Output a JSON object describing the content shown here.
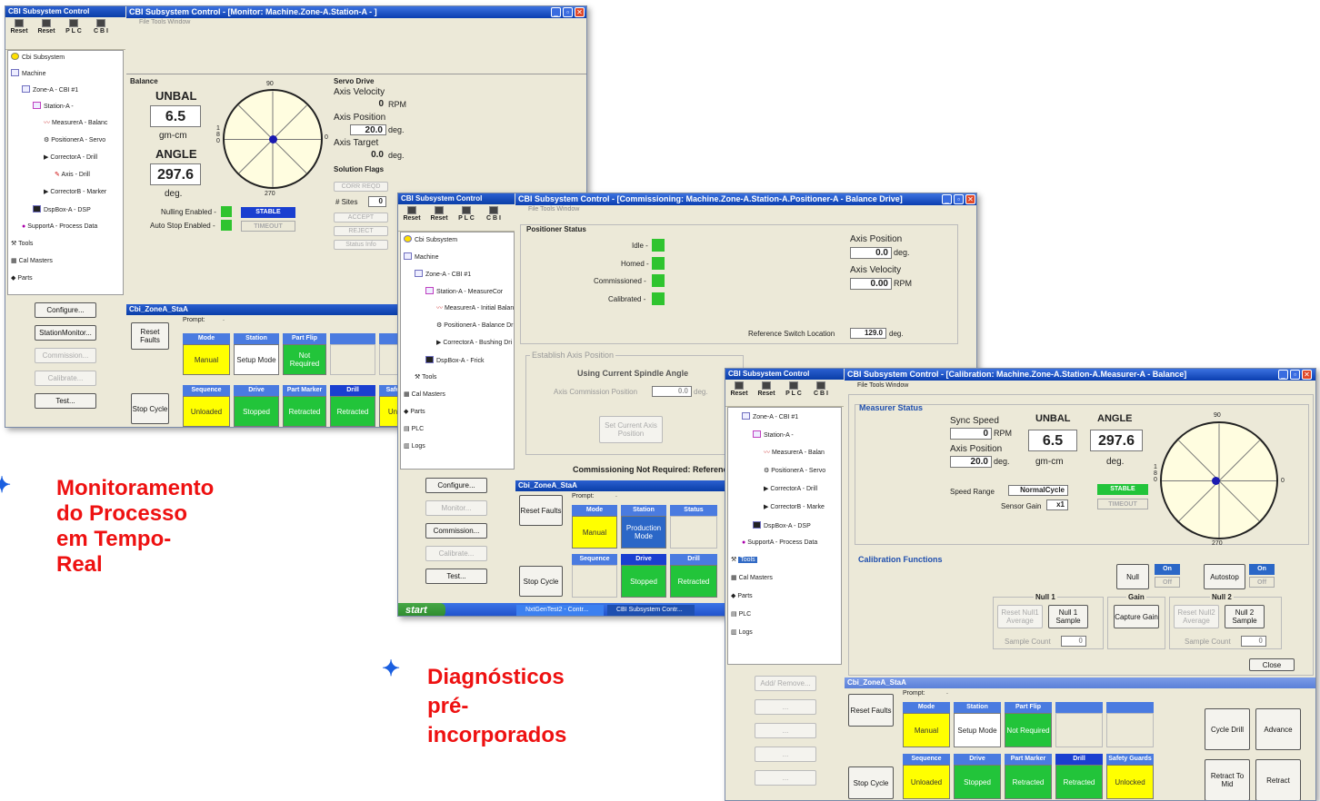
{
  "captions": [
    {
      "text": "Monitoramento do Processo em Tempo-Real",
      "lines": [
        "Monitoramento",
        "do Processo",
        "em Tempo-",
        "Real"
      ]
    },
    {
      "text": "Diagnósticos pré-incorporados",
      "lines": [
        "Diagnósticos",
        "pré-",
        "incorporados"
      ]
    }
  ],
  "sidebar": {
    "title": "CBI Subsystem Control",
    "toolbar": [
      "Reset",
      "Reset",
      "P L C",
      "C B I"
    ]
  },
  "w1": {
    "title": "CBI Subsystem Control - [Monitor: Machine.Zone-A.Station-A - ]",
    "menu": "File   Tools   Window",
    "tree": [
      "Cbi Subsystem",
      "Machine",
      "Zone-A - CBI #1",
      "Station-A -",
      "MeasurerA - Balanc",
      "PositionerA - Servo",
      "CorrectorA - Drill",
      "Axis - Drill",
      "CorrectorB - Marker",
      "DspBox-A - DSP",
      "SupportA - Process Data",
      "Tools",
      "Cal Masters",
      "Parts"
    ],
    "buttons": [
      "Configure...",
      "StationMonitor...",
      "Commission...",
      "Calibrate...",
      "Test..."
    ],
    "balance": {
      "title": "Balance",
      "unbal_label": "UNBAL",
      "unbal": "6.5",
      "unit": "gm-cm",
      "angle_label": "ANGLE",
      "angle": "297.6",
      "deg": "deg.",
      "null": "Nulling Enabled -",
      "auto": "Auto Stop Enabled -",
      "stable": "STABLE",
      "timeout": "TIMEOUT",
      "dial": {
        "top": "90",
        "bottom": "270",
        "left": "180",
        "right": "0"
      }
    },
    "servo": {
      "title": "Servo Drive",
      "vel_label": "Axis Velocity",
      "vel": "0",
      "vel_unit": "RPM",
      "pos_label": "Axis Position",
      "pos": "20.0",
      "pos_unit": "deg.",
      "tgt_label": "Axis Target",
      "tgt": "0.0",
      "tgt_unit": "deg.",
      "flags": "Solution Flags",
      "corr": "CORR REQD",
      "sites_label": "# Sites",
      "sites": "0",
      "accept": "ACCEPT",
      "reject": "REJECT",
      "status": "Status Info"
    },
    "station": {
      "title": "Cbi_ZoneA_StaA",
      "prompt": "Prompt:",
      "prompt_val": ".",
      "reset": "Reset Faults",
      "stop": "Stop Cycle",
      "heads1": [
        "Mode",
        "Station",
        "Part Flip",
        "",
        ""
      ],
      "row1": [
        "Manual",
        "Setup Mode",
        "Not Required",
        "",
        ""
      ],
      "heads2": [
        "Sequence",
        "Drive",
        "Part Marker",
        "Drill",
        "Safe"
      ],
      "row2": [
        "Unloaded",
        "Stopped",
        "Retracted",
        "Retracted",
        "Un"
      ]
    }
  },
  "w2": {
    "title": "CBI Subsystem Control - [Commissioning: Machine.Zone-A.Station-A.Positioner-A - Balance Drive]",
    "menu": "File   Tools   Window",
    "tree": [
      "Cbi Subsystem",
      "Machine",
      "Zone-A - CBI #1",
      "Station-A - MeasureCor",
      "MeasurerA - Initial Balan",
      "PositionerA - Balance Dr",
      "CorrectorA - Bushing Dri",
      "DspBox-A - Frick",
      "Tools",
      "Cal Masters",
      "Parts",
      "PLC",
      "Logs"
    ],
    "buttons": [
      "Configure...",
      "Monitor...",
      "Commission...",
      "Calibrate...",
      "Test..."
    ],
    "status": {
      "title": "Positioner Status",
      "flags": [
        "Idle -",
        "Homed -",
        "Commissioned -",
        "Calibrated -"
      ],
      "pos_label": "Axis Position",
      "pos": "0.0",
      "pos_unit": "deg.",
      "vel_label": "Axis Velocity",
      "vel": "0.00",
      "vel_unit": "RPM",
      "ref_label": "Reference Switch Location",
      "ref": "129.0",
      "ref_unit": "deg."
    },
    "establish": {
      "title": "Establish Axis Position",
      "sub": "Using Current Spindle Angle",
      "acp_label": "Axis Commission Position",
      "acp": "0.0",
      "acp_unit": "deg.",
      "btn": "Set Current Axis Position",
      "note": "Commissioning Not Required: Reference"
    },
    "station": {
      "title": "Cbi_ZoneA_StaA",
      "prompt": "Prompt:",
      "prompt_val": ".",
      "reset": "Reset Faults",
      "stop": "Stop Cycle",
      "heads1": [
        "Mode",
        "Station",
        "Status"
      ],
      "row1": [
        "Manual",
        "Production Mode",
        ""
      ],
      "heads2": [
        "Sequence",
        "Drive",
        "Drill"
      ],
      "row2": [
        "",
        "Stopped",
        "Retracted"
      ]
    },
    "taskbar": {
      "start": "start",
      "items": [
        "NxtGenTest2 - Contr...",
        "CBI Subsystem Contr..."
      ]
    }
  },
  "w3": {
    "title": "CBI Subsystem Control - [Calibration: Machine.Zone-A.Station-A.Measurer-A - Balance]",
    "menu": "File   Tools   Window",
    "tree": [
      "Zone-A - CBI #1",
      "Station-A -",
      "MeasurerA - Balan",
      "PositionerA - Servo",
      "CorrectorA - Drill",
      "CorrectorB - Marke",
      "DspBox-A - DSP",
      "SupportA - Process Data",
      "Tools",
      "Cal Masters",
      "Parts",
      "PLC",
      "Logs"
    ],
    "buttons": [
      "Add/ Remove...",
      "...",
      "...",
      "...",
      "..."
    ],
    "measurer": {
      "title": "Measurer Status",
      "sync_label": "Sync Speed",
      "sync": "0",
      "sync_unit": "RPM",
      "pos_label": "Axis Position",
      "pos": "20.0",
      "pos_unit": "deg.",
      "unbal_label": "UNBAL",
      "unbal": "6.5",
      "unit": "gm-cm",
      "angle_label": "ANGLE",
      "angle": "297.6",
      "deg": "deg.",
      "range_label": "Speed Range",
      "range": "NormalCycle",
      "gain_label": "Sensor Gain",
      "gain": "x1",
      "stable": "STABLE",
      "timeout": "TIMEOUT",
      "dial": {
        "top": "90",
        "bottom": "270",
        "left": "180",
        "right": "0"
      }
    },
    "cal": {
      "title": "Calibration Functions",
      "null_btn": "Null",
      "autostop_btn": "Autostop",
      "on": "On",
      "off": "Off",
      "null1": "Null 1",
      "null1_reset": "Reset Null1 Average",
      "null1_sample": "Null 1 Sample",
      "gain": "Gain",
      "capture": "Capture Gain",
      "null2": "Null 2",
      "null2_reset": "Reset Null2 Average",
      "null2_sample": "Null 2 Sample",
      "sample_count": "Sample Count",
      "count1": "0",
      "count2": "0",
      "close": "Close"
    },
    "station": {
      "title": "Cbi_ZoneA_StaA",
      "prompt": "Prompt:",
      "prompt_val": ".",
      "reset": "Reset Faults",
      "stop": "Stop Cycle",
      "heads1": [
        "Mode",
        "Station",
        "Part Flip",
        "",
        ""
      ],
      "row1": [
        "Manual",
        "Setup Mode",
        "Not Required",
        "",
        ""
      ],
      "heads2": [
        "Sequence",
        "Drive",
        "Part Marker",
        "Drill",
        "Safety Guards"
      ],
      "row2": [
        "Unloaded",
        "Stopped",
        "Retracted",
        "Retracted",
        "Unlocked"
      ],
      "side": [
        "Cycle Drill",
        "Advance",
        "Retract To Mid",
        "Retract"
      ]
    }
  }
}
